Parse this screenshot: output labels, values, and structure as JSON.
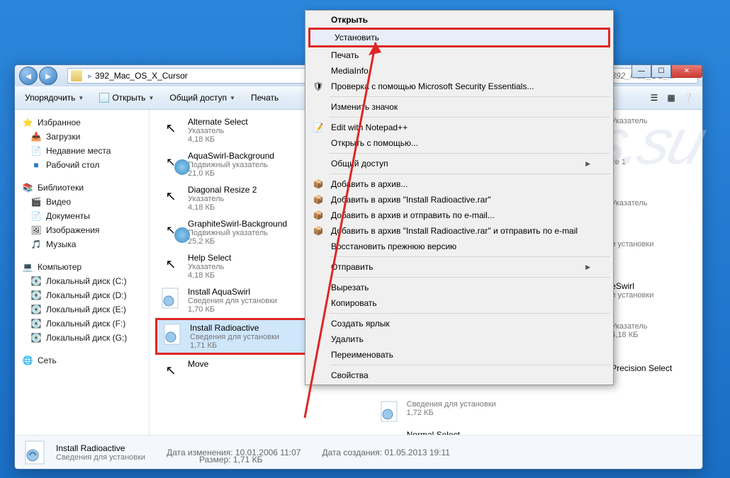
{
  "address": {
    "folder": "392_Mac_OS_X_Cursor"
  },
  "search": {
    "placeholder": "Поиск: 392_Mac_OS_..."
  },
  "toolbar": {
    "organize": "Упорядочить",
    "open": "Открыть",
    "share": "Общий доступ",
    "print": "Печать"
  },
  "sidebar": {
    "fav": "Избранное",
    "downloads": "Загрузки",
    "recent": "Недавние места",
    "desktop": "Рабочий стол",
    "libs": "Библиотеки",
    "video": "Видео",
    "docs": "Документы",
    "images": "Изображения",
    "music": "Музыка",
    "computer": "Компьютер",
    "diskC": "Локальный диск (C:)",
    "diskD": "Локальный диск (D:)",
    "diskE": "Локальный диск (E:)",
    "diskF": "Локальный диск (F:)",
    "diskG": "Локальный диск (G:)",
    "network": "Сеть"
  },
  "labels": {
    "cursor": "Указатель",
    "animCursor": "Подвижный указатель",
    "installInfo": "Сведения для установки"
  },
  "files": {
    "col1": [
      {
        "name": "Alternate Select",
        "desc": "Указатель",
        "size": "4,18 КБ",
        "ico": "arrow"
      },
      {
        "name": "AquaSwirl-Background",
        "desc": "Подвижный указатель",
        "size": "21,0 КБ",
        "ico": "ani"
      },
      {
        "name": "Diagonal Resize 2",
        "desc": "Указатель",
        "size": "4,18 КБ",
        "ico": "arrow"
      },
      {
        "name": "GraphiteSwirl-Background",
        "desc": "Подвижный указатель",
        "size": "25,2 КБ",
        "ico": "ani"
      },
      {
        "name": "Help Select",
        "desc": "Указатель",
        "size": "4,18 КБ",
        "ico": "arrow"
      },
      {
        "name": "Install AquaSwirl",
        "desc": "Сведения для установки",
        "size": "1,70 КБ",
        "ico": "inf"
      },
      {
        "name": "Install Radioactive",
        "desc": "Сведения для установки",
        "size": "1,71 КБ",
        "ico": "inf",
        "sel": true
      },
      {
        "name": "Move",
        "desc": "",
        "size": "",
        "ico": "arrow"
      }
    ],
    "col2": [
      {
        "name": "",
        "desc": "Указатель",
        "size": "",
        "ico": ""
      },
      {
        "name": "",
        "desc": "ze 1",
        "size": "",
        "ico": ""
      },
      {
        "name": "",
        "desc": "Указатель",
        "size": "",
        "ico": ""
      },
      {
        "name": "",
        "desc": "и установки",
        "size": "",
        "ico": ""
      },
      {
        "name": "eSwirl",
        "desc": "и установки",
        "size": "",
        "ico": ""
      },
      {
        "name": "",
        "desc": "Указатель",
        "size": "4,18 КБ",
        "ico": "hand"
      },
      {
        "name": "Precision Select",
        "desc": "",
        "size": "",
        "ico": ""
      }
    ],
    "col2b": [
      {
        "name": "",
        "desc": "Сведения для установки",
        "size": "1,72 КБ",
        "ico": "inf"
      },
      {
        "name": "Normal Select",
        "desc": "",
        "size": "",
        "ico": ""
      }
    ]
  },
  "details": {
    "name": "Install Radioactive",
    "desc": "Сведения для установки",
    "modLabel": "Дата изменения:",
    "mod": "10.01.2006 11:07",
    "sizeLabel": "Размер:",
    "size": "1,71 КБ",
    "createdLabel": "Дата создания:",
    "created": "01.05.2013 19:11"
  },
  "ctx": {
    "open": "Открыть",
    "install": "Установить",
    "print": "Печать",
    "mediainfo": "MediaInfo",
    "mse": "Проверка с помощью Microsoft Security Essentials...",
    "changeIcon": "Изменить значок",
    "notepad": "Edit with Notepad++",
    "openWith": "Открыть с помощью...",
    "shareAccess": "Общий доступ",
    "addArchive": "Добавить в архив...",
    "addRar": "Добавить в архив \"Install Radioactive.rar\"",
    "addEmail": "Добавить в архив и отправить по e-mail...",
    "addRarEmail": "Добавить в архив \"Install Radioactive.rar\" и отправить по e-mail",
    "restore": "Восстановить прежнюю версию",
    "send": "Отправить",
    "cut": "Вырезать",
    "copy": "Копировать",
    "shortcut": "Создать ярлык",
    "delete": "Удалить",
    "rename": "Переименовать",
    "props": "Свойства"
  }
}
